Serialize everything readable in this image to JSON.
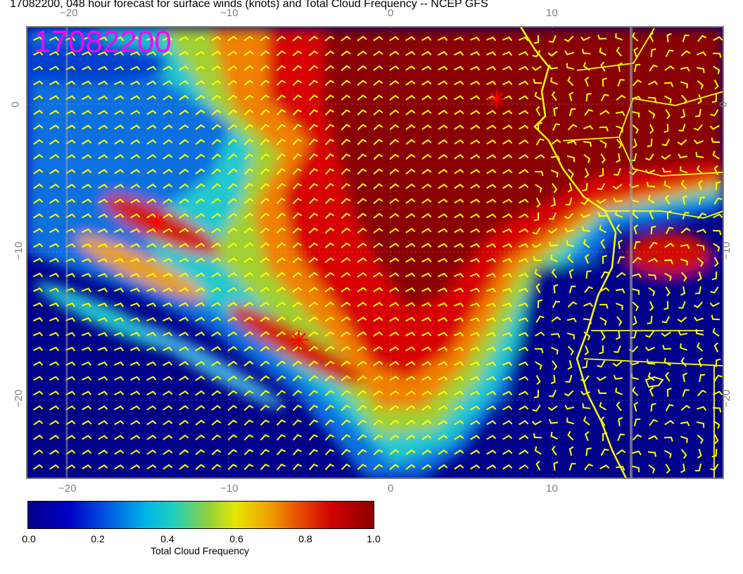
{
  "title": "17082200, 048 hour forecast for surface winds (knots) and Total Cloud Frequency -- NCEP GFS",
  "timestamp_label": "17082200",
  "axes": {
    "lon_ticks": [
      "−20",
      "−10",
      "0",
      "10"
    ],
    "lat_ticks": [
      "0",
      "−10",
      "−20"
    ]
  },
  "colorbar": {
    "title": "Total Cloud Frequency",
    "tick_labels": [
      "0.0",
      "0.2",
      "0.4",
      "0.6",
      "0.8",
      "1.0"
    ],
    "min": 0.0,
    "max": 1.0
  },
  "colors": {
    "wind_barbs": "#ffff00",
    "coastline": "#ffff00",
    "timestamp": "#ff00ff",
    "storm_markers": "#ff0000",
    "axis_ticks": "#7f7f7f"
  },
  "map": {
    "lon_range": [
      -22.5,
      20.5
    ],
    "lat_range": [
      -25,
      5
    ],
    "storm_markers": [
      {
        "lon": 6.5,
        "lat": 0.2
      },
      {
        "lon": -14.5,
        "lat": -8.0
      },
      {
        "lon": -5.7,
        "lat": -15.8
      }
    ]
  }
}
